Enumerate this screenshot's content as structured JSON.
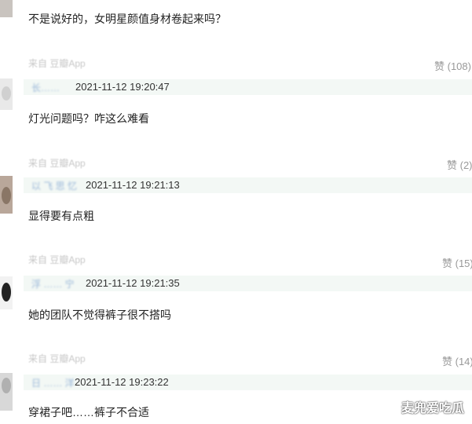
{
  "comments": [
    {
      "text": "不是说好的，女明星颜值身材卷起来吗？"
    },
    {
      "source": "来自 豆瓣App",
      "likes": "赞 (108)",
      "user": "长……",
      "time": "2021-11-12 19:20:47",
      "text": "灯光问题吗？咋这么难看"
    },
    {
      "source": "来自 豆瓣App",
      "likes": "赞 (2)",
      "user": "以 飞 思 忆",
      "time": "2021-11-12 19:21:13",
      "text": "显得要有点粗"
    },
    {
      "source": "来自 豆瓣App",
      "likes": "赞 (15)",
      "user": "浮 …… 宁",
      "time": "2021-11-12 19:21:35",
      "text": "她的团队不觉得裤子很不搭吗"
    },
    {
      "source": "来自 豆瓣App",
      "likes": "赞 (14)",
      "user": "日 …… 洋",
      "time": "2021-11-12 19:23:22",
      "text": "穿裙子吧……裤子不合适"
    }
  ],
  "watermark": "麦兜爱吃瓜"
}
